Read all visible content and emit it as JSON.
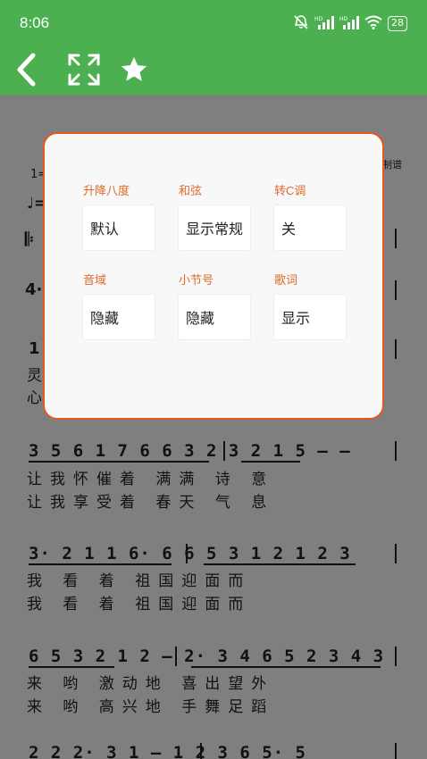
{
  "status": {
    "time": "8:06",
    "hd1": "HD",
    "hd2": "HD",
    "battery": "28"
  },
  "toolbar": {
    "back_icon": "chevron-left-icon",
    "fullscreen_icon": "expand-icon",
    "favorite_icon": "star-icon"
  },
  "sheet": {
    "header_left": "1=",
    "header_right": "制谱",
    "tempo_note": "♩=",
    "repeat_start": "𝄆",
    "row_start": "4·",
    "left_margin_1": "1",
    "left_margin_2": "灵",
    "left_margin_3": "心",
    "system2": {
      "notes": "3 5  6 1  7 6  6 3   2 3 2 1  5  –  –",
      "lyric1": "让我怀催着 满满 诗   意",
      "lyric2": "让我享受着 春天 气   息"
    },
    "system3": {
      "notes": "3· 2  1 1  6·  6   6 5  3 1  2 1 2  3",
      "lyric1": "我  看  着    祖国迎面而",
      "lyric2": "我  看  着    祖国迎面而"
    },
    "system4": {
      "notes": "6 5  3 2 1  2  –   2· 3  4 6  5 2  3  4 3",
      "lyric1": "来       哟   激动地 喜出望外",
      "lyric2": "来       哟   高兴地 手舞足蹈"
    },
    "system5": {
      "notes": "2 2  2· 3  1  –   1 2  3 6  5·  5"
    }
  },
  "dialog": {
    "options": [
      {
        "label": "升降八度",
        "value": "默认"
      },
      {
        "label": "和弦",
        "value": "显示常规"
      },
      {
        "label": "转C调",
        "value": "关"
      },
      {
        "label": "音域",
        "value": "隐藏"
      },
      {
        "label": "小节号",
        "value": "隐藏"
      },
      {
        "label": "歌词",
        "value": "显示"
      }
    ]
  },
  "colors": {
    "accent_green": "#4caf50",
    "dialog_border": "#e35a1f",
    "label_orange": "#e06a2a"
  }
}
